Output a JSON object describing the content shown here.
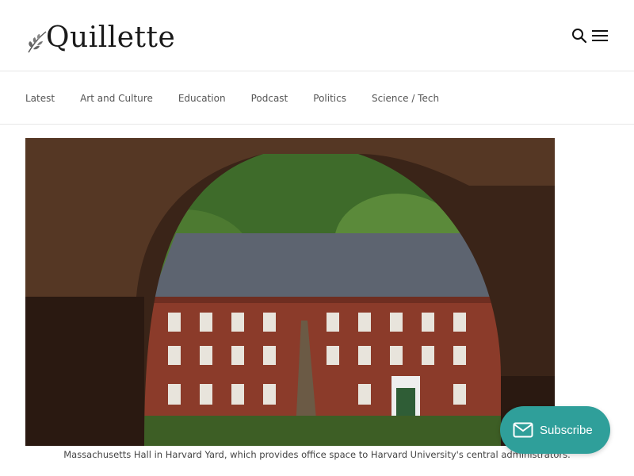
{
  "header": {
    "logo_text": "Quillette",
    "icons": [
      "search-icon",
      "menu-icon"
    ]
  },
  "nav": {
    "items": [
      {
        "label": "Latest"
      },
      {
        "label": "Art and Culture"
      },
      {
        "label": "Education"
      },
      {
        "label": "Podcast"
      },
      {
        "label": "Politics"
      },
      {
        "label": "Science / Tech"
      }
    ]
  },
  "hero": {
    "caption": "Massachusetts Hall in Harvard Yard, which provides office space to Harvard University's central administrators."
  },
  "subscribe": {
    "label": "Subscribe",
    "icon": "mail-icon",
    "color": "#2f9f9a"
  }
}
